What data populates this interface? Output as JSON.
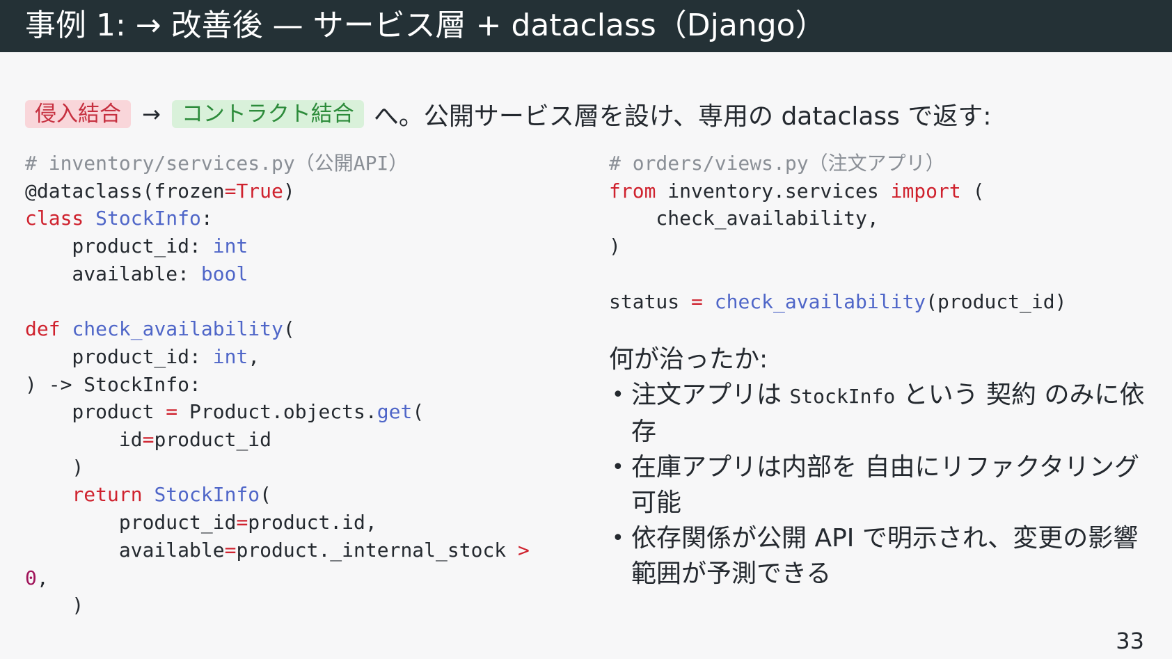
{
  "slide": {
    "title": "事例 1: → 改善後 — サービス層 + dataclass（Django）",
    "page_number": "33"
  },
  "intro": {
    "badge_before": "侵入結合",
    "arrow": "→",
    "badge_after": "コントラクト結合",
    "text": "へ。公開サービス層を設け、専用の dataclass で返す:"
  },
  "left_code": {
    "comment": "# inventory/services.py（公開API）",
    "l2_decorator": "@dataclass(frozen",
    "l2_eq": "=",
    "l2_true": "True",
    "l2_close": ")",
    "l3_kw": "class",
    "l3_sp": " ",
    "l3_name": "StockInfo",
    "l3_colon": ":",
    "l4_field": "    product_id: ",
    "l4_type": "int",
    "l5_field": "    available: ",
    "l5_type": "bool",
    "l7_kw": "def",
    "l7_sp": " ",
    "l7_name": "check_availability",
    "l7_paren": "(",
    "l8_field": "    product_id: ",
    "l8_type": "int",
    "l8_comma": ",",
    "l9_text": ") -> StockInfo:",
    "l10_a": "    product ",
    "l10_eq": "=",
    "l10_b": " Product.objects.",
    "l10_get": "get",
    "l10_paren": "(",
    "l11_a": "        id",
    "l11_eq": "=",
    "l11_b": "product_id",
    "l12": "    )",
    "l13_kw": "    return",
    "l13_sp": " ",
    "l13_name": "StockInfo",
    "l13_paren": "(",
    "l14_a": "        product_id",
    "l14_eq": "=",
    "l14_b": "product.id,",
    "l15_a": "        available",
    "l15_eq": "=",
    "l15_b": "product._internal_stock ",
    "l15_gt": ">",
    "l16_num": "0",
    "l16_comma": ",",
    "l17": "    )"
  },
  "right_code": {
    "comment": "# orders/views.py（注文アプリ）",
    "r2_from": "from",
    "r2_mod": " inventory.services ",
    "r2_import": "import",
    "r2_paren": " (",
    "r3": "    check_availability,",
    "r4": ")",
    "r6_a": "status ",
    "r6_eq": "=",
    "r6_sp": " ",
    "r6_fn": "check_availability",
    "r6_args": "(product_id)"
  },
  "answer": {
    "title": "何が治ったか:",
    "b1_pre": "注文アプリは ",
    "b1_code": "StockInfo",
    "b1_post": " という 契約 のみに依存",
    "b2": "在庫アプリは内部を 自由にリファクタリング可能",
    "b3": "依存関係が公開 API で明示され、変更の影響範囲が予測できる"
  }
}
